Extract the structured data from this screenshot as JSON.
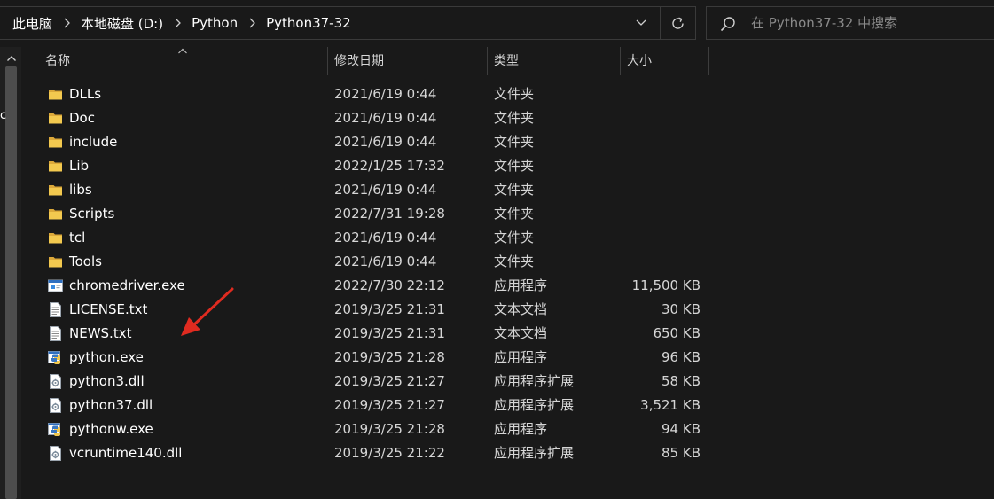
{
  "address_bar": {
    "crumbs": [
      "此电脑",
      "本地磁盘 (D:)",
      "Python",
      "Python37-32"
    ]
  },
  "search": {
    "placeholder": "在 Python37-32 中搜索"
  },
  "columns": {
    "name": "名称",
    "date": "修改日期",
    "type": "类型",
    "size": "大小"
  },
  "files": [
    {
      "name": "DLLs",
      "date": "2021/6/19 0:44",
      "type": "文件夹",
      "size": "",
      "icon": "folder-icon"
    },
    {
      "name": "Doc",
      "date": "2021/6/19 0:44",
      "type": "文件夹",
      "size": "",
      "icon": "folder-icon"
    },
    {
      "name": "include",
      "date": "2021/6/19 0:44",
      "type": "文件夹",
      "size": "",
      "icon": "folder-icon"
    },
    {
      "name": "Lib",
      "date": "2022/1/25 17:32",
      "type": "文件夹",
      "size": "",
      "icon": "folder-icon"
    },
    {
      "name": "libs",
      "date": "2021/6/19 0:44",
      "type": "文件夹",
      "size": "",
      "icon": "folder-icon"
    },
    {
      "name": "Scripts",
      "date": "2022/7/31 19:28",
      "type": "文件夹",
      "size": "",
      "icon": "folder-icon"
    },
    {
      "name": "tcl",
      "date": "2021/6/19 0:44",
      "type": "文件夹",
      "size": "",
      "icon": "folder-icon"
    },
    {
      "name": "Tools",
      "date": "2021/6/19 0:44",
      "type": "文件夹",
      "size": "",
      "icon": "folder-icon"
    },
    {
      "name": "chromedriver.exe",
      "date": "2022/7/30 22:12",
      "type": "应用程序",
      "size": "11,500 KB",
      "icon": "exe-icon"
    },
    {
      "name": "LICENSE.txt",
      "date": "2019/3/25 21:31",
      "type": "文本文档",
      "size": "30 KB",
      "icon": "text-file-icon"
    },
    {
      "name": "NEWS.txt",
      "date": "2019/3/25 21:31",
      "type": "文本文档",
      "size": "650 KB",
      "icon": "text-file-icon"
    },
    {
      "name": "python.exe",
      "date": "2019/3/25 21:28",
      "type": "应用程序",
      "size": "96 KB",
      "icon": "python-icon"
    },
    {
      "name": "python3.dll",
      "date": "2019/3/25 21:27",
      "type": "应用程序扩展",
      "size": "58 KB",
      "icon": "dll-icon"
    },
    {
      "name": "python37.dll",
      "date": "2019/3/25 21:27",
      "type": "应用程序扩展",
      "size": "3,521 KB",
      "icon": "dll-icon"
    },
    {
      "name": "pythonw.exe",
      "date": "2019/3/25 21:28",
      "type": "应用程序",
      "size": "94 KB",
      "icon": "python-icon"
    },
    {
      "name": "vcruntime140.dll",
      "date": "2019/3/25 21:22",
      "type": "应用程序扩展",
      "size": "85 KB",
      "icon": "dll-icon"
    }
  ],
  "nav_pane": {
    "stub_text": "c"
  },
  "colors": {
    "background": "#191919",
    "folder": "#f3c94f",
    "annotation_arrow": "#e02b20"
  }
}
